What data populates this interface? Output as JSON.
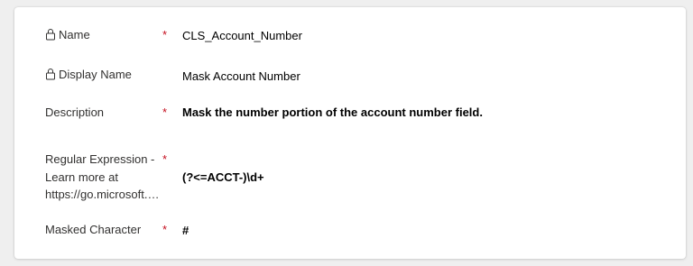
{
  "fields": [
    {
      "label": "Name",
      "locked": true,
      "required": true,
      "value": "CLS_Account_Number"
    },
    {
      "label": "Display Name",
      "locked": true,
      "required": false,
      "value": "Mask Account Number"
    },
    {
      "label": "Description",
      "locked": false,
      "required": true,
      "value": "Mask the number portion of the account number field."
    },
    {
      "label_lines": [
        "Regular Expression -",
        "Learn more at",
        "https://go.microsoft.c…"
      ],
      "locked": false,
      "required": true,
      "value": "(?<=ACCT-)\\d+"
    },
    {
      "label": "Masked Character",
      "locked": false,
      "required": true,
      "value": "#"
    }
  ],
  "required_marker": "*",
  "icons": {
    "lock": "lock-icon"
  },
  "colors": {
    "required": "#c50f1f",
    "label": "#323130",
    "value": "#000000",
    "card": "#ffffff",
    "background": "#efefef"
  }
}
